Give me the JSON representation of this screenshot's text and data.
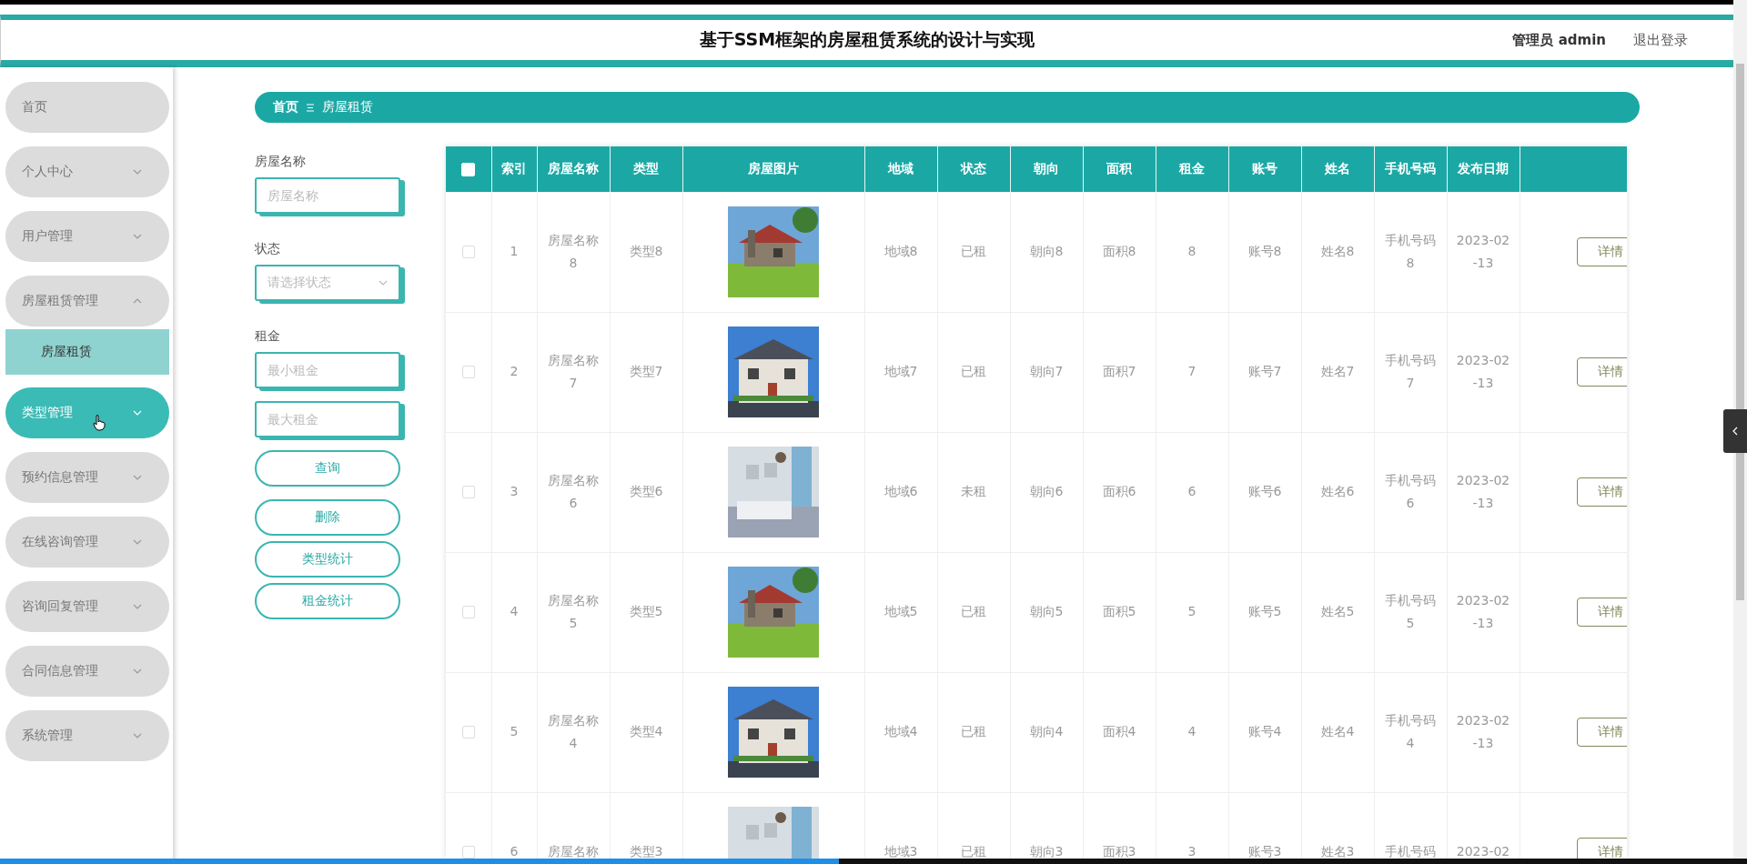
{
  "header": {
    "title": "基于SSM框架的房屋租赁系统的设计与实现",
    "user": "管理员 admin",
    "logout": "退出登录"
  },
  "sidebar": {
    "items": [
      {
        "label": "首页",
        "kind": "link",
        "selected": false
      },
      {
        "label": "个人中心",
        "kind": "group",
        "expanded": false,
        "selected": false
      },
      {
        "label": "用户管理",
        "kind": "group",
        "expanded": false,
        "selected": false
      },
      {
        "label": "房屋租赁管理",
        "kind": "group",
        "expanded": true,
        "selected": false,
        "children": [
          {
            "label": "房屋租赁",
            "selected": true
          }
        ]
      },
      {
        "label": "类型管理",
        "kind": "group",
        "expanded": false,
        "selected": true
      },
      {
        "label": "预约信息管理",
        "kind": "group",
        "expanded": false,
        "selected": false
      },
      {
        "label": "在线咨询管理",
        "kind": "group",
        "expanded": false,
        "selected": false
      },
      {
        "label": "咨询回复管理",
        "kind": "group",
        "expanded": false,
        "selected": false
      },
      {
        "label": "合同信息管理",
        "kind": "group",
        "expanded": false,
        "selected": false
      },
      {
        "label": "系统管理",
        "kind": "group",
        "expanded": false,
        "selected": false
      }
    ]
  },
  "breadcrumb": [
    "首页",
    "房屋租赁"
  ],
  "filters": {
    "name_label": "房屋名称",
    "name_placeholder": "房屋名称",
    "status_label": "状态",
    "status_placeholder": "请选择状态",
    "rent_label": "租金",
    "min_placeholder": "最小租金",
    "max_placeholder": "最大租金"
  },
  "buttons": [
    "查询",
    "删除",
    "类型统计",
    "租金统计"
  ],
  "table": {
    "select_all_checked": false,
    "columns": [
      "索引",
      "房屋名称",
      "类型",
      "房屋图片",
      "地域",
      "状态",
      "朝向",
      "面积",
      "租金",
      "账号",
      "姓名",
      "手机号码",
      "发布日期"
    ],
    "rows": [
      {
        "checked": false,
        "cells": [
          "1",
          "房屋名称8",
          "类型8",
          "",
          "地域8",
          "已租",
          "朝向8",
          "面积8",
          "8",
          "账号8",
          "姓名8",
          "手机号码8",
          "2023-02-13"
        ],
        "action": "详情"
      },
      {
        "checked": false,
        "cells": [
          "2",
          "房屋名称7",
          "类型7",
          "",
          "地域7",
          "已租",
          "朝向7",
          "面积7",
          "7",
          "账号7",
          "姓名7",
          "手机号码7",
          "2023-02-13"
        ],
        "action": "详情"
      },
      {
        "checked": false,
        "cells": [
          "3",
          "房屋名称6",
          "类型6",
          "",
          "地域6",
          "未租",
          "朝向6",
          "面积6",
          "6",
          "账号6",
          "姓名6",
          "手机号码6",
          "2023-02-13"
        ],
        "action": "详情"
      },
      {
        "checked": false,
        "cells": [
          "4",
          "房屋名称5",
          "类型5",
          "",
          "地域5",
          "已租",
          "朝向5",
          "面积5",
          "5",
          "账号5",
          "姓名5",
          "手机号码5",
          "2023-02-13"
        ],
        "action": "详情"
      },
      {
        "checked": false,
        "cells": [
          "5",
          "房屋名称4",
          "类型4",
          "",
          "地域4",
          "已租",
          "朝向4",
          "面积4",
          "4",
          "账号4",
          "姓名4",
          "手机号码4",
          "2023-02-13"
        ],
        "action": "详情"
      },
      {
        "checked": false,
        "cells": [
          "6",
          "房屋名称",
          "类型3",
          "",
          "地域3",
          "已租",
          "朝向3",
          "面积3",
          "3",
          "账号3",
          "姓名3",
          "手机号码",
          "2023-02"
        ],
        "action": "详情"
      }
    ]
  },
  "playback": {
    "level": 0.48
  }
}
